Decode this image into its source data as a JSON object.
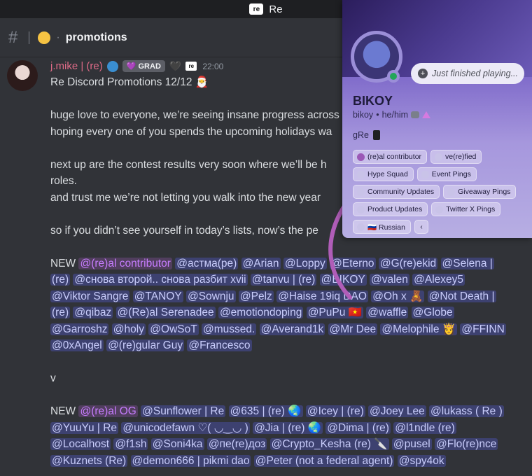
{
  "window": {
    "title": "Re",
    "logo_text": "re"
  },
  "channel": {
    "name": "promotions"
  },
  "message": {
    "author": "j.mike | (re)",
    "tag": "GRAD",
    "tag_logo": "re",
    "time": "22:00",
    "title": "Re Discord Promotions 12/12 🎅",
    "lines": [
      "huge love to everyone, we’re seeing insane progress across",
      "hoping every one of you spends the upcoming holidays wa",
      "",
      "next up are the contest results very soon where we’ll be h",
      "roles.",
      "and trust me we’re not letting you walk into the new year",
      "",
      "so if you didn’t see yourself in today’s lists, now’s the pe",
      ""
    ],
    "new_label": "NEW",
    "group1_role": "@(re)al contributor",
    "group1_mentions": [
      [
        "@астма(ре)",
        "@Arian",
        "@Loppy",
        "@Eterno",
        "@G(re)ekid",
        "@Selena |"
      ],
      [
        "(re)",
        "@снова второй.. снова разбит xvii",
        "@tanvu | (re)",
        "@BIKOY",
        "@valen",
        "@Alexey5"
      ],
      [
        "@Viktor Sangre",
        "@TANOY",
        "@Sownju",
        "@Pelz",
        "@Haise 19iq DAO",
        "@Oh x 🧸",
        "@Not Death |"
      ],
      [
        "(re)",
        "@qibaz",
        "@(Re)al Serenadee",
        "@emotiondoping",
        "@PuPu 🇻🇳",
        "@waffle",
        "@Globe"
      ],
      [
        "@Garroshz",
        "@holy",
        "@OwSoT",
        "@mussed.",
        "@Averand1k",
        "@Mr Dee",
        "@Melophile 👸",
        "@FFINN"
      ],
      [
        "@0xAngel",
        "@(re)gular Guy",
        "@Francesco"
      ]
    ],
    "separator": "v",
    "group2_role": "@(re)al OG",
    "group2_mentions": [
      [
        "@Sunflower | Re",
        "@635 | (re) 🌏",
        "@Icey | (re)",
        "@Joey Lee",
        "@lukass ( Re )"
      ],
      [
        "@YuuYu | Re",
        "@unicodefawn ♡( ◡‿◡ )",
        "@Jia | (re) 🌏",
        "@Dima | (re)",
        "@l1ndle (re)"
      ],
      [
        "@Localhost",
        "@f1sh",
        "@Soni4ka",
        "@пе(re)доз",
        "@Crypto_Kesha (re) 🔪",
        "@pusel",
        "@Flo(re)nce"
      ],
      [
        "@Kuznets (Re)",
        "@demon666 | pikmi dao",
        "@Peter (not a federal agent)",
        "@spy4ok"
      ]
    ]
  },
  "profile": {
    "display_name": "BIKOY",
    "username": "bikoy",
    "pronouns": "he/him",
    "status": "Just finished playing...",
    "bio": "gRe",
    "roles": [
      "(re)al contributor",
      "ve(re)fied",
      "Hype Squad",
      "Event Pings",
      "Community Updates",
      "Giveaway Pings",
      "Product Updates",
      "Twitter X Pings",
      "🇷🇺 Russian"
    ],
    "more_label": "‹"
  },
  "colors": {
    "background": "#313338",
    "author": "#e06b88",
    "mention_bg": "#3d4270",
    "role_mention": "#c77dff",
    "arrow": "#b05db8"
  }
}
